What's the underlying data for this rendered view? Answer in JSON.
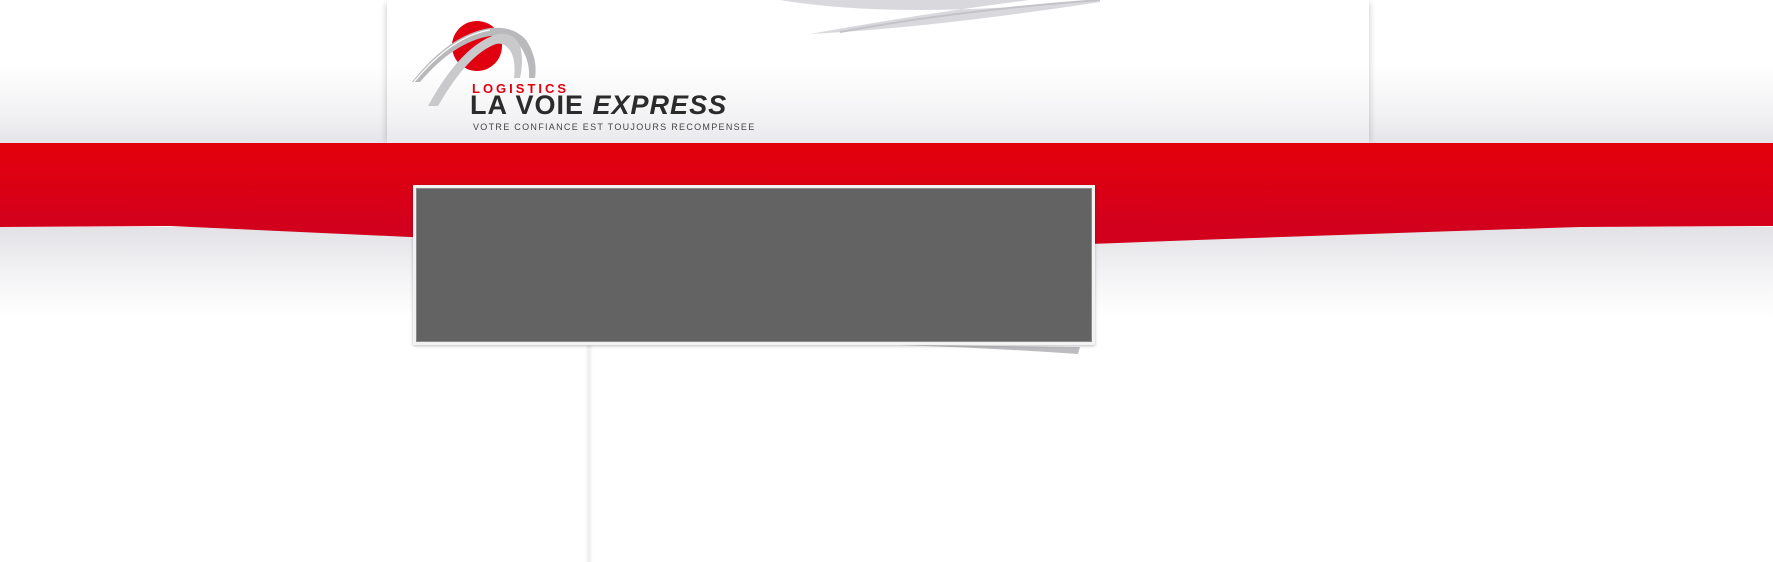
{
  "logo": {
    "small_text": "LOGISTICS",
    "name_part1": "LA VOIE",
    "name_part2": "EXPRESS",
    "tagline": "VOTRE CONFIANCE EST TOUJOURS RECOMPENSEE",
    "icon": "bridge-arc-logo-icon"
  },
  "banner": {
    "state": "empty"
  },
  "colors": {
    "brand_red": "#e0000f",
    "dark_red": "#c8001c",
    "banner_gray": "#636363",
    "logo_text": "#2b2b2b"
  }
}
